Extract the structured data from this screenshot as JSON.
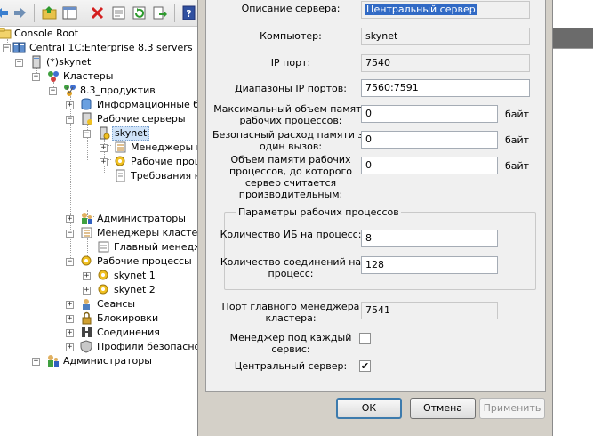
{
  "tree": {
    "console_root": "Console Root",
    "central": "Central 1C:Enterprise 8.3 servers",
    "skynet_host": "(*)skynet",
    "clusters": "Кластеры",
    "cluster": "8.3_продуктив",
    "infobases": "Информационные базы",
    "working_servers": "Рабочие серверы",
    "server_skynet": "skynet",
    "cluster_managers_sub": "Менеджеры кластера",
    "working_processes_sub": "Рабочие процессы",
    "requirements": "Требования назначения",
    "administrators": "Администраторы",
    "cluster_managers": "Менеджеры кластера",
    "main_manager": "Главный менеджер",
    "working_processes": "Рабочие процессы",
    "proc1": "skynet 1",
    "proc2": "skynet 2",
    "sessions": "Сеансы",
    "locks": "Блокировки",
    "connections": "Соединения",
    "security_profiles": "Профили безопасности",
    "root_administrators": "Администраторы"
  },
  "dialog": {
    "server_description": {
      "label": "Описание сервера:",
      "value": "Центральный сервер"
    },
    "computer": {
      "label": "Компьютер:",
      "value": "skynet"
    },
    "ip_port": {
      "label": "IP порт:",
      "value": "7540"
    },
    "ip_ranges": {
      "label": "Диапазоны IP портов:",
      "value": "7560:7591"
    },
    "max_memory": {
      "label": "Максимальный объем памяти рабочих процессов:",
      "value": "0",
      "unit": "байт"
    },
    "safe_memory": {
      "label": "Безопасный расход памяти за один вызов:",
      "value": "0",
      "unit": "байт"
    },
    "memory_threshold": {
      "label": "Объем памяти рабочих процессов, до которого сервер считается производительным:",
      "value": "0",
      "unit": "байт"
    },
    "group_title": "Параметры рабочих процессов",
    "ib_per_process": {
      "label": "Количество ИБ на процесс:",
      "value": "8"
    },
    "connections_per_process": {
      "label": "Количество соединений на процесс:",
      "value": "128"
    },
    "main_manager_port": {
      "label": "Порт главного менеджера кластера:",
      "value": "7541"
    },
    "manager_per_service": {
      "label": "Менеджер под каждый сервис:",
      "checked": false
    },
    "central_server": {
      "label": "Центральный сервер:",
      "checked": true,
      "check_glyph": "✔"
    },
    "buttons": {
      "ok": "ОК",
      "cancel": "Отмена",
      "apply": "Применить"
    }
  },
  "colors": {
    "dialog_bg": "#f0f0f0",
    "selection": "#316ac5",
    "tree_selection": "#cfe3f9",
    "disabled_text": "#8d8d8d"
  },
  "icons": {
    "toolbar": [
      "back-arrow-icon",
      "forward-arrow-icon",
      "up-folder-icon",
      "show-hide-tree-icon",
      "delete-icon",
      "properties-icon",
      "refresh-icon",
      "export-list-icon",
      "help-icon"
    ]
  }
}
